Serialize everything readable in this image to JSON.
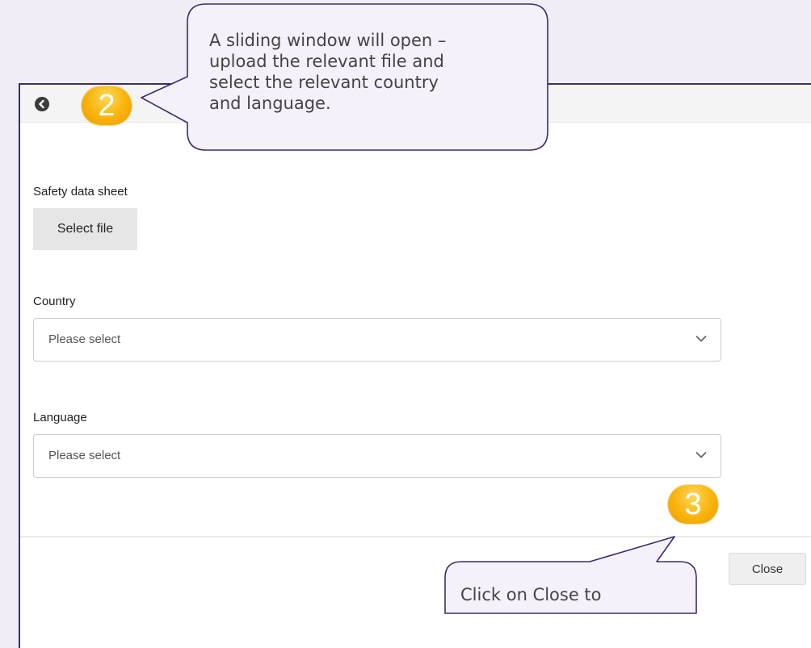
{
  "panel": {
    "back_icon": "chevron-left-circle-icon",
    "sds_label": "Safety data sheet",
    "select_file_label": "Select file",
    "country_label": "Country",
    "country_value": "Please select",
    "language_label": "Language",
    "language_value": "Please select",
    "dropdown_icon": "chevron-down-icon",
    "close_label": "Close"
  },
  "annotations": {
    "step2": {
      "number": "2",
      "text": "A sliding window will open –\nupload the relevant file and\nselect the relevant country\nand language."
    },
    "step3": {
      "number": "3",
      "text": "Click on Close to"
    },
    "colors": {
      "badge": "#f8b30a",
      "callout_fill": "#f5f0fa",
      "callout_stroke": "#3a2d6b",
      "background": "#f1edf6"
    }
  }
}
